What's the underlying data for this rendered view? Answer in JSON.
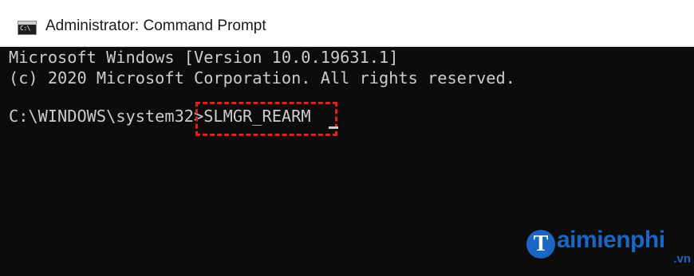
{
  "window": {
    "title": "Administrator: Command Prompt",
    "icon": "cmd-icon",
    "icon_glyph": "C:\\"
  },
  "console": {
    "lines": [
      "Microsoft Windows [Version 10.0.19631.1]",
      "(c) 2020 Microsoft Corporation. All rights reserved."
    ],
    "prompt_path": "C:\\WINDOWS\\system32",
    "prompt_symbol": ">",
    "command": "SLMGR_REARM"
  },
  "highlight": {
    "color": "#e02020",
    "style": "dashed"
  },
  "watermark": {
    "badge_letter": "T",
    "text": "aimienphi",
    "suffix": ".vn",
    "color": "#1a66c4"
  }
}
